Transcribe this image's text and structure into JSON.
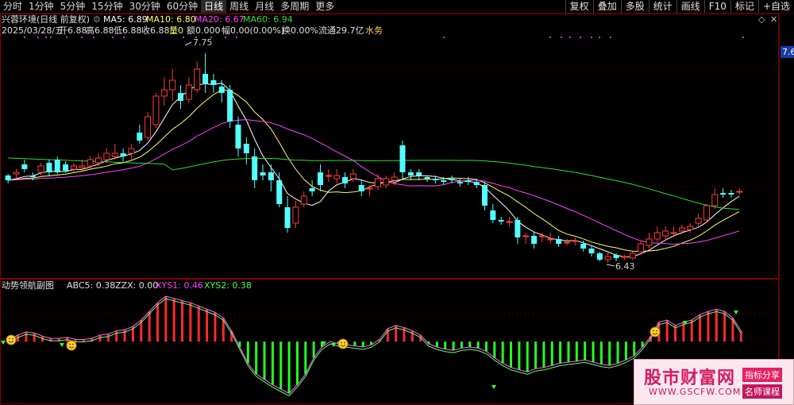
{
  "tabs": [
    "分时",
    "1分钟",
    "5分钟",
    "15分钟",
    "30分钟",
    "60分钟",
    "日线",
    "周线",
    "月线",
    "多周期",
    "更多"
  ],
  "active_tab": "日线",
  "right_buttons": [
    "复权",
    "叠加",
    "多股",
    "统计",
    "画线",
    "F10",
    "标记",
    "+自选"
  ],
  "main_header": {
    "stock": "兴蓉环境(日线 前复权)",
    "ma5": "MA5: 6.89",
    "ma10": "MA10: 6.80",
    "ma20": "MA20: 6.67",
    "ma60": "MA60: 6.94"
  },
  "info_line": {
    "date": "2025/03/28/五",
    "open": "开6.88",
    "high": "高6.88",
    "low": "低6.88",
    "close": "收6.88",
    "vol": "量0",
    "amount": "额0.000",
    "change": "幅0.00(0.00%)",
    "turnover": "换0.00%",
    "float": "流通29.7亿",
    "industry": "水务"
  },
  "price_labels": {
    "high_mark": "7.75",
    "low_mark": "6.43",
    "axis_value": "7.6"
  },
  "sub_header": {
    "name": "动势领航副图",
    "abc5": "ABC5: 0.38",
    "zzx": "ZZX: 0.00",
    "xys1": "XYS1: 0.46",
    "xys2": "XYS2: 0.38"
  },
  "logo": {
    "title": "股市财富网",
    "url": "WWW.GSCFW.COM",
    "tag1": "指标分享",
    "tag2": "名师课程"
  },
  "colors": {
    "up": "#ff3c3c",
    "down": "#54ffff",
    "ma5": "#ffffff",
    "ma10": "#ffff66",
    "ma20": "#ff44ff",
    "ma60": "#33dd33",
    "hist_up": "#ff2a2a",
    "hist_down": "#22ff22"
  },
  "chart_data": {
    "type": "candlestick",
    "candles": [
      [
        6.98,
        6.95,
        6.99,
        6.93
      ],
      [
        6.99,
        7.0,
        7.02,
        6.96
      ],
      [
        7.05,
        7.02,
        7.08,
        7.0
      ],
      [
        6.98,
        6.97,
        7.0,
        6.95
      ],
      [
        7.0,
        7.04,
        7.06,
        6.98
      ],
      [
        7.06,
        7.0,
        7.08,
        6.98
      ],
      [
        7.08,
        7.0,
        7.1,
        6.99
      ],
      [
        7.05,
        7.01,
        7.07,
        7.0
      ],
      [
        7.02,
        7.04,
        7.06,
        7.0
      ],
      [
        7.03,
        7.04,
        7.08,
        7.01
      ],
      [
        7.04,
        7.08,
        7.1,
        7.02
      ],
      [
        7.06,
        7.09,
        7.12,
        7.04
      ],
      [
        7.08,
        7.12,
        7.15,
        7.06
      ],
      [
        7.1,
        7.12,
        7.18,
        7.08
      ],
      [
        7.12,
        7.1,
        7.15,
        7.06
      ],
      [
        7.12,
        7.15,
        7.18,
        7.08
      ],
      [
        7.25,
        7.2,
        7.3,
        7.18
      ],
      [
        7.22,
        7.35,
        7.38,
        7.2
      ],
      [
        7.3,
        7.48,
        7.5,
        7.28
      ],
      [
        7.48,
        7.52,
        7.6,
        7.42
      ],
      [
        7.52,
        7.58,
        7.65,
        7.45
      ],
      [
        7.5,
        7.45,
        7.55,
        7.4
      ],
      [
        7.46,
        7.55,
        7.6,
        7.44
      ],
      [
        7.52,
        7.65,
        7.7,
        7.5
      ],
      [
        7.62,
        7.56,
        7.75,
        7.5
      ],
      [
        7.58,
        7.55,
        7.62,
        7.5
      ],
      [
        7.54,
        7.5,
        7.58,
        7.44
      ],
      [
        7.52,
        7.32,
        7.55,
        7.28
      ],
      [
        7.3,
        7.15,
        7.35,
        7.1
      ],
      [
        7.18,
        7.12,
        7.22,
        7.05
      ],
      [
        7.1,
        6.95,
        7.15,
        6.9
      ],
      [
        7.0,
        6.98,
        7.05,
        6.95
      ],
      [
        7.0,
        6.95,
        7.05,
        6.88
      ],
      [
        6.95,
        6.8,
        7.0,
        6.78
      ],
      [
        6.78,
        6.65,
        6.85,
        6.62
      ],
      [
        6.68,
        6.78,
        6.82,
        6.65
      ],
      [
        6.8,
        6.85,
        6.88,
        6.78
      ],
      [
        6.9,
        6.88,
        6.95,
        6.85
      ],
      [
        7.0,
        6.92,
        7.05,
        6.88
      ],
      [
        6.98,
        6.98,
        7.02,
        6.94
      ],
      [
        6.96,
        6.98,
        7.02,
        6.93
      ],
      [
        6.97,
        6.93,
        7.0,
        6.9
      ],
      [
        6.96,
        6.99,
        7.02,
        6.94
      ],
      [
        6.92,
        6.88,
        6.95,
        6.85
      ],
      [
        6.9,
        6.9,
        6.92,
        6.85
      ],
      [
        6.91,
        6.96,
        6.99,
        6.89
      ],
      [
        6.92,
        6.96,
        6.98,
        6.9
      ],
      [
        6.95,
        6.97,
        7.0,
        6.92
      ],
      [
        7.17,
        7.0,
        7.2,
        6.95
      ],
      [
        7.0,
        6.98,
        7.02,
        6.95
      ],
      [
        7.0,
        6.98,
        7.02,
        6.95
      ],
      [
        6.97,
        6.96,
        6.98,
        6.94
      ],
      [
        6.96,
        6.95,
        6.98,
        6.93
      ],
      [
        6.95,
        6.94,
        6.97,
        6.92
      ],
      [
        6.96,
        6.95,
        6.98,
        6.93
      ],
      [
        6.94,
        6.93,
        6.96,
        6.91
      ],
      [
        6.95,
        6.94,
        6.97,
        6.92
      ],
      [
        6.94,
        6.92,
        6.96,
        6.9
      ],
      [
        6.92,
        6.79,
        6.94,
        6.76
      ],
      [
        6.76,
        6.7,
        6.8,
        6.68
      ],
      [
        6.7,
        6.69,
        6.72,
        6.67
      ],
      [
        6.69,
        6.69,
        6.72,
        6.66
      ],
      [
        6.7,
        6.59,
        6.72,
        6.55
      ],
      [
        6.6,
        6.6,
        6.62,
        6.55
      ],
      [
        6.6,
        6.55,
        6.62,
        6.52
      ],
      [
        6.6,
        6.6,
        6.62,
        6.56
      ],
      [
        6.58,
        6.58,
        6.62,
        6.55
      ],
      [
        6.58,
        6.55,
        6.6,
        6.53
      ],
      [
        6.56,
        6.56,
        6.58,
        6.54
      ],
      [
        6.57,
        6.57,
        6.59,
        6.54
      ],
      [
        6.55,
        6.52,
        6.57,
        6.5
      ],
      [
        6.52,
        6.49,
        6.54,
        6.47
      ],
      [
        6.49,
        6.45,
        6.5,
        6.44
      ],
      [
        6.45,
        6.47,
        6.5,
        6.43
      ],
      [
        6.48,
        6.46,
        6.49,
        6.44
      ],
      [
        6.47,
        6.47,
        6.48,
        6.45
      ],
      [
        6.46,
        6.49,
        6.5,
        6.45
      ],
      [
        6.5,
        6.55,
        6.57,
        6.48
      ],
      [
        6.54,
        6.58,
        6.62,
        6.52
      ],
      [
        6.58,
        6.62,
        6.66,
        6.56
      ],
      [
        6.6,
        6.63,
        6.66,
        6.58
      ],
      [
        6.62,
        6.62,
        6.66,
        6.6
      ],
      [
        6.63,
        6.65,
        6.67,
        6.61
      ],
      [
        6.64,
        6.66,
        6.68,
        6.62
      ],
      [
        6.68,
        6.71,
        6.74,
        6.66
      ],
      [
        6.7,
        6.79,
        6.8,
        6.68
      ],
      [
        6.79,
        6.86,
        6.9,
        6.77
      ],
      [
        6.87,
        6.86,
        6.9,
        6.84
      ],
      [
        6.87,
        6.86,
        6.89,
        6.84
      ],
      [
        6.88,
        6.88,
        6.9,
        6.86
      ]
    ],
    "price_range": [
      6.35,
      7.85
    ],
    "indicator": {
      "hist": [
        0.02,
        0.06,
        0.09,
        0.08,
        0.05,
        0.03,
        0.03,
        0.04,
        0.02,
        0.02,
        0.03,
        0.06,
        0.07,
        0.1,
        0.11,
        0.14,
        0.2,
        0.28,
        0.36,
        0.42,
        0.4,
        0.38,
        0.36,
        0.33,
        0.3,
        0.27,
        0.22,
        0.1,
        -0.05,
        -0.2,
        -0.3,
        -0.35,
        -0.4,
        -0.44,
        -0.48,
        -0.4,
        -0.3,
        -0.15,
        -0.05,
        0.0,
        -0.02,
        -0.03,
        -0.04,
        -0.05,
        -0.03,
        0.02,
        0.12,
        0.15,
        0.13,
        0.1,
        0.06,
        -0.02,
        -0.05,
        -0.07,
        -0.08,
        -0.06,
        -0.05,
        -0.06,
        -0.09,
        -0.15,
        -0.2,
        -0.24,
        -0.26,
        -0.28,
        -0.25,
        -0.24,
        -0.22,
        -0.2,
        -0.19,
        -0.18,
        -0.17,
        -0.19,
        -0.21,
        -0.22,
        -0.2,
        -0.17,
        -0.13,
        -0.05,
        0.05,
        0.18,
        0.2,
        0.15,
        0.18,
        0.2,
        0.25,
        0.28,
        0.3,
        0.28,
        0.22,
        0.1
      ],
      "range": [
        -0.55,
        0.45
      ]
    }
  }
}
